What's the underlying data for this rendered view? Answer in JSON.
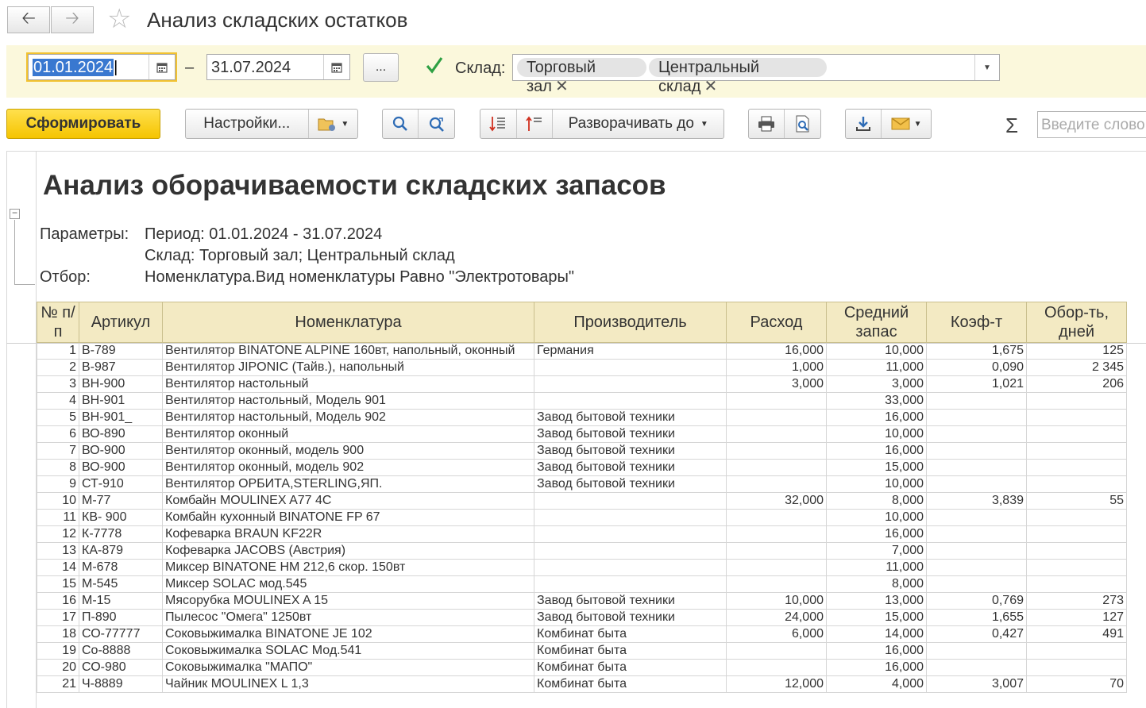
{
  "window": {
    "title": "Анализ складских остатков"
  },
  "params": {
    "date_from": "01.01.2024",
    "dash": "–",
    "date_to": "31.07.2024",
    "more_label": "...",
    "warehouse_label": "Склад:",
    "warehouse_checked": true,
    "warehouse_tags": [
      "Торговый зал",
      "Центральный склад"
    ]
  },
  "toolbar": {
    "generate_label": "Сформировать",
    "settings_label": "Настройки...",
    "expand_label": "Разворачивать до",
    "search_placeholder": "Введите слово"
  },
  "report": {
    "title": "Анализ оборачиваемости складских запасов",
    "params_label": "Параметры:",
    "period_text": "Период: 01.01.2024 - 31.07.2024",
    "warehouse_text": "Склад: Торговый зал; Центральный склад",
    "filter_label": "Отбор:",
    "filter_text": "Номенклатура.Вид номенклатуры Равно \"Электротовары\"",
    "columns": [
      "№ п/п",
      "Артикул",
      "Номенклатура",
      "Производитель",
      "Расход",
      "Средний запас",
      "Коэф-т",
      "Обор-ть, дней"
    ],
    "rows": [
      [
        "1",
        "B-789",
        "Вентилятор BINATONE ALPINE 160вт, напольный, оконный",
        "Германия",
        "16,000",
        "10,000",
        "1,675",
        "125"
      ],
      [
        "2",
        "B-987",
        "Вентилятор JIPONIC (Тайв.), напольный",
        "",
        "1,000",
        "11,000",
        "0,090",
        "2 345"
      ],
      [
        "3",
        "ВН-900",
        "Вентилятор настольный",
        "",
        "3,000",
        "3,000",
        "1,021",
        "206"
      ],
      [
        "4",
        "ВН-901",
        "Вентилятор настольный, Модель 901",
        "",
        "",
        "33,000",
        "",
        ""
      ],
      [
        "5",
        "ВН-901_",
        "Вентилятор настольный, Модель 902",
        "Завод бытовой техники",
        "",
        "16,000",
        "",
        ""
      ],
      [
        "6",
        "ВО-890",
        "Вентилятор оконный",
        "Завод бытовой техники",
        "",
        "10,000",
        "",
        ""
      ],
      [
        "7",
        "ВО-900",
        "Вентилятор оконный, модель 900",
        "Завод бытовой техники",
        "",
        "16,000",
        "",
        ""
      ],
      [
        "8",
        "ВО-900",
        "Вентилятор оконный, модель 902",
        "Завод бытовой техники",
        "",
        "15,000",
        "",
        ""
      ],
      [
        "9",
        "СТ-910",
        "Вентилятор ОРБИТА,STERLING,ЯП.",
        "Завод бытовой техники",
        "",
        "10,000",
        "",
        ""
      ],
      [
        "10",
        "М-77",
        "Комбайн MOULINEX  A77 4C",
        "",
        "32,000",
        "8,000",
        "3,839",
        "55"
      ],
      [
        "11",
        "КВ- 900",
        "Комбайн кухонный BINATONE FP 67",
        "",
        "",
        "10,000",
        "",
        ""
      ],
      [
        "12",
        "К-7778",
        "Кофеварка BRAUN KF22R",
        "",
        "",
        "16,000",
        "",
        ""
      ],
      [
        "13",
        "КА-879",
        "Кофеварка JACOBS (Австрия)",
        "",
        "",
        "7,000",
        "",
        ""
      ],
      [
        "14",
        "М-678",
        "Миксер BINATONE HM 212,6 скор. 150вт",
        "",
        "",
        "11,000",
        "",
        ""
      ],
      [
        "15",
        "М-545",
        "Миксер SOLAC мод.545",
        "",
        "",
        "8,000",
        "",
        ""
      ],
      [
        "16",
        "М-15",
        "Мясорубка MOULINEX  A 15",
        "Завод бытовой техники",
        "10,000",
        "13,000",
        "0,769",
        "273"
      ],
      [
        "17",
        "П-890",
        "Пылесос \"Омега\" 1250вт",
        "Завод бытовой техники",
        "24,000",
        "15,000",
        "1,655",
        "127"
      ],
      [
        "18",
        "СО-77777",
        "Соковыжималка  BINATONE JE 102",
        "Комбинат быта",
        "6,000",
        "14,000",
        "0,427",
        "491"
      ],
      [
        "19",
        "Со-8888",
        "Соковыжималка  SOLAC  Мод.541",
        "Комбинат быта",
        "",
        "16,000",
        "",
        ""
      ],
      [
        "20",
        "СО-980",
        "Соковыжималка \"МАПО\"",
        "Комбинат быта",
        "",
        "16,000",
        "",
        ""
      ],
      [
        "21",
        "Ч-8889",
        "Чайник MOULINEX L 1,3",
        "Комбинат быта",
        "12,000",
        "4,000",
        "3,007",
        "70"
      ]
    ]
  }
}
